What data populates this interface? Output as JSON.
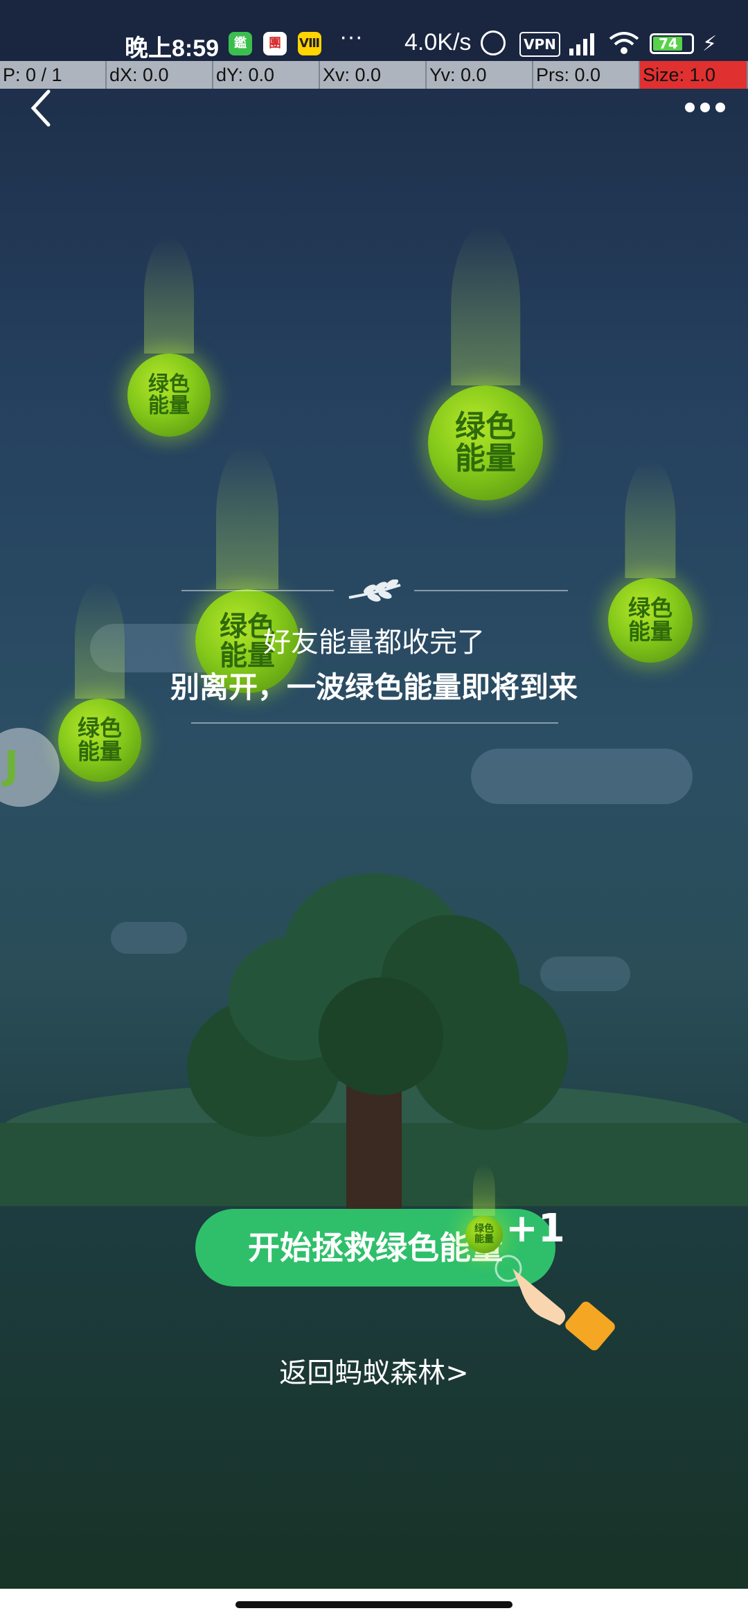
{
  "status_bar": {
    "time": "晚上8:59",
    "app_icon_1": "鑑",
    "app_icon_2": "團",
    "app_icon_3": "Ⅷ",
    "overflow": "···",
    "net_speed": "4.0K/s",
    "vpn": "VPN",
    "battery": "74"
  },
  "debug": {
    "p": "P: 0 / 1",
    "dx": "dX: 0.0",
    "dy": "dY: 0.0",
    "xv": "Xv: 0.0",
    "yv": "Yv: 0.0",
    "prs": "Prs: 0.0",
    "size": "Size: 1.0"
  },
  "header": {
    "back_icon": "chevron-left-icon",
    "more_icon": "more-dots-icon"
  },
  "energy_ball_label": "绿色能量",
  "message": {
    "line1": "好友能量都收完了",
    "line2": "别离开，一波绿色能量即将到来"
  },
  "cta": {
    "label": "开始拯救绿色能量",
    "plus": "+1"
  },
  "back_link": "返回蚂蚁森林>",
  "colors": {
    "accent_green": "#2fbf6b",
    "ball_green": "#84c91a",
    "debug_red": "#e03030"
  }
}
